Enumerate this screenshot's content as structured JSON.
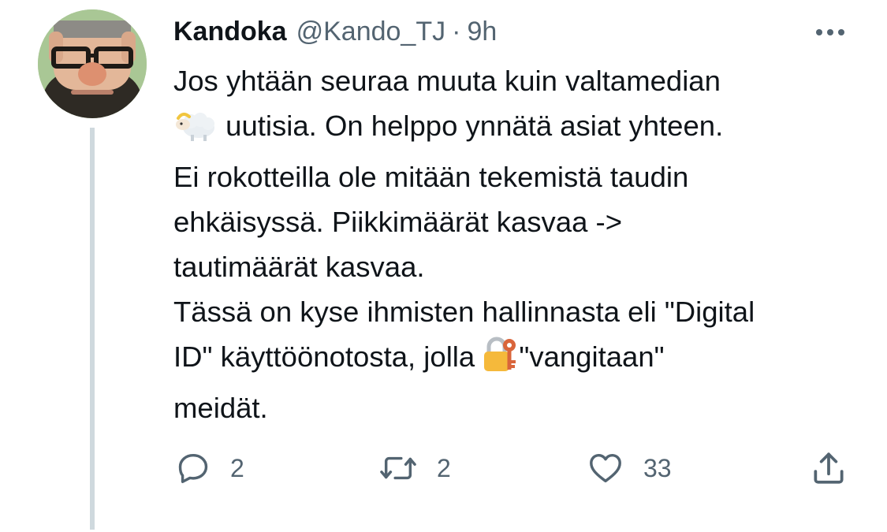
{
  "tweet": {
    "author": {
      "display_name": "Kandoka",
      "handle": "@Kando_TJ",
      "avatar_icon": "cartoon-old-man-glasses-avatar"
    },
    "separator": "·",
    "time": "9h",
    "more_icon": "more-dots-icon",
    "text": {
      "line1": "Jos yhtään seuraa muuta kuin  valtamedian",
      "line2": "uutisia. On helppo ynnätä asiat yhteen.",
      "line3": "Ei rokotteilla ole mitään tekemistä taudin",
      "line4": "ehkäisyssä. Piikkimäärät kasvaa ->",
      "line5": "tautimäärät kasvaa.",
      "line6": "Tässä on kyse ihmisten hallinnasta eli \"Digital",
      "line7a": "ID\" käyttöönotosta, jolla",
      "line7b": "\"vangitaan\"",
      "line8": "meidät."
    },
    "emojis": {
      "sheep": "sheep-emoji",
      "lock_key": "locked-with-key-emoji"
    },
    "actions": {
      "replies": "2",
      "retweets": "2",
      "likes": "33"
    },
    "colors": {
      "text": "#0f1419",
      "secondary": "#536471",
      "thread_line": "#cfd9de"
    }
  }
}
